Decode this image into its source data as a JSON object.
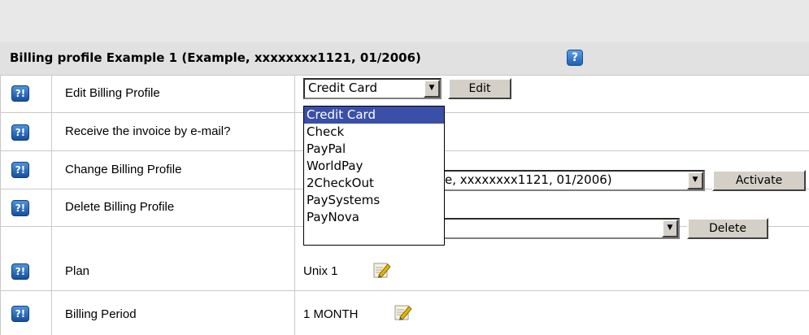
{
  "header": {
    "title": "Billing profile Example 1 (Example, xxxxxxxx1121, 01/2006)",
    "help_icon": "help-icon"
  },
  "rows": [
    {
      "label": "Edit Billing Profile",
      "help_icon": "help-icon"
    },
    {
      "label": "Receive the invoice by e-mail?",
      "help_icon": "help-icon"
    },
    {
      "label": "Change Billing Profile",
      "help_icon": "help-icon"
    },
    {
      "label": "Delete Billing Profile",
      "help_icon": "help-icon"
    },
    {
      "label": "Plan",
      "help_icon": "help-icon"
    },
    {
      "label": "Billing Period",
      "help_icon": "help-icon"
    }
  ],
  "edit_profile": {
    "select_value": "Credit Card",
    "button_label": "Edit",
    "options": [
      "Credit Card",
      "Check",
      "PayPal",
      "WorldPay",
      "2CheckOut",
      "PaySystems",
      "PayNova"
    ]
  },
  "change_profile": {
    "select_value_visible": "e, xxxxxxxx1121, 01/2006)",
    "button_label": "Activate"
  },
  "delete_profile": {
    "select_value": "",
    "button_label": "Delete"
  },
  "plan": {
    "value": "Unix 1",
    "edit_icon": "edit-icon"
  },
  "billing_period": {
    "value": "1 MONTH",
    "edit_icon": "edit-icon"
  },
  "colors": {
    "header_bg": "#e8e8e8",
    "help_blue": "#1f5fb3",
    "dropdown_highlight": "#3a4fa8"
  }
}
